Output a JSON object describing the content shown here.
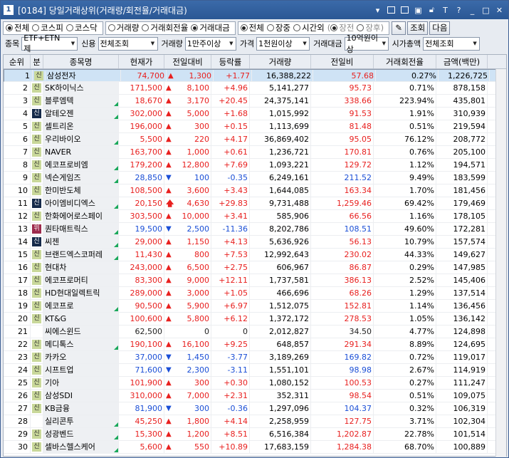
{
  "window": {
    "number": "1",
    "title": "[0184] 당일거래상위(거래량/회전율/거래대금)"
  },
  "toolbar1": {
    "market": [
      "전체",
      "코스피",
      "코스닥"
    ],
    "sort": [
      "거래량",
      "거래회전율",
      "거래대금"
    ],
    "session": [
      "전체",
      "장중",
      "시간외"
    ],
    "timeopt": [
      "장전",
      "장후"
    ],
    "query": "조회",
    "next": "다음"
  },
  "toolbar2": {
    "item_label": "종목",
    "item_value": "ETF+ETN 제",
    "credit_label": "신용",
    "credit_value": "전체조회",
    "volume_label": "거래량",
    "volume_value": "1만주이상",
    "price_label": "가격",
    "price_value": "1천원이상",
    "amount_label": "거래대금",
    "amount_value": "10억원이상",
    "cap_label": "시가총액",
    "cap_value": "전체조회"
  },
  "headers": [
    "순위",
    "분",
    "종목명",
    "현재가",
    "전일대비",
    "등락률",
    "거래량",
    "전일비",
    "거래회전율",
    "금액(백만)"
  ],
  "rows": [
    {
      "rank": "1",
      "badge": "신",
      "bt": "g",
      "name": "삼성전자",
      "price": "74,700",
      "dir": "up",
      "chg": "1,300",
      "rate": "+1.77",
      "vol": "16,388,222",
      "prev": "57.68",
      "turn": "0.27%",
      "amt": "1,226,725",
      "tri": false,
      "sel": true
    },
    {
      "rank": "2",
      "badge": "신",
      "bt": "g",
      "name": "SK하이닉스",
      "price": "171,500",
      "dir": "up",
      "chg": "8,100",
      "rate": "+4.96",
      "vol": "5,141,277",
      "prev": "95.73",
      "turn": "0.71%",
      "amt": "878,158",
      "tri": false
    },
    {
      "rank": "3",
      "badge": "신",
      "bt": "g",
      "name": "블루엠텍",
      "price": "18,670",
      "dir": "up",
      "chg": "3,170",
      "rate": "+20.45",
      "vol": "24,375,141",
      "prev": "338.66",
      "turn": "223.94%",
      "amt": "435,801",
      "tri": true
    },
    {
      "rank": "4",
      "badge": "신",
      "bt": "k",
      "name": "알테오젠",
      "price": "302,000",
      "dir": "up",
      "chg": "5,000",
      "rate": "+1.68",
      "vol": "1,015,992",
      "prev": "91.53",
      "turn": "1.91%",
      "amt": "310,939",
      "tri": true
    },
    {
      "rank": "5",
      "badge": "신",
      "bt": "g",
      "name": "셀트리온",
      "price": "196,000",
      "dir": "up",
      "chg": "300",
      "rate": "+0.15",
      "vol": "1,113,699",
      "prev": "81.48",
      "turn": "0.51%",
      "amt": "219,594",
      "tri": false
    },
    {
      "rank": "6",
      "badge": "신",
      "bt": "g",
      "name": "우리바이오",
      "price": "5,500",
      "dir": "up",
      "chg": "220",
      "rate": "+4.17",
      "vol": "36,869,402",
      "prev": "95.05",
      "turn": "76.12%",
      "amt": "208,772",
      "tri": true
    },
    {
      "rank": "7",
      "badge": "신",
      "bt": "g",
      "name": "NAVER",
      "price": "163,700",
      "dir": "up",
      "chg": "1,000",
      "rate": "+0.61",
      "vol": "1,236,721",
      "prev": "170.81",
      "turn": "0.76%",
      "amt": "205,100",
      "tri": false
    },
    {
      "rank": "8",
      "badge": "신",
      "bt": "g",
      "name": "에코프로비엠",
      "price": "179,200",
      "dir": "up",
      "chg": "12,800",
      "rate": "+7.69",
      "vol": "1,093,221",
      "prev": "129.72",
      "turn": "1.12%",
      "amt": "194,571",
      "tri": true
    },
    {
      "rank": "9",
      "badge": "신",
      "bt": "g",
      "name": "넥슨게임즈",
      "price": "28,850",
      "dir": "down",
      "chg": "100",
      "rate": "-0.35",
      "vol": "6,249,161",
      "prev": "211.52",
      "turn": "9.49%",
      "amt": "183,599",
      "tri": true
    },
    {
      "rank": "10",
      "badge": "신",
      "bt": "g",
      "name": "한미반도체",
      "price": "108,500",
      "dir": "up",
      "chg": "3,600",
      "rate": "+3.43",
      "vol": "1,644,085",
      "prev": "163.34",
      "turn": "1.70%",
      "amt": "181,456",
      "tri": false
    },
    {
      "rank": "11",
      "badge": "신",
      "bt": "k",
      "name": "아이엠비디엑스",
      "price": "20,150",
      "dir": "upper",
      "chg": "4,630",
      "rate": "+29.83",
      "vol": "9,731,488",
      "prev": "1,259.46",
      "turn": "69.42%",
      "amt": "179,469",
      "tri": true
    },
    {
      "rank": "12",
      "badge": "신",
      "bt": "g",
      "name": "한화에어로스페이",
      "price": "303,500",
      "dir": "up",
      "chg": "10,000",
      "rate": "+3.41",
      "vol": "585,906",
      "prev": "66.56",
      "turn": "1.16%",
      "amt": "178,105",
      "tri": false
    },
    {
      "rank": "13",
      "badge": "위",
      "bt": "r",
      "name": "퀀타매트릭스",
      "price": "19,500",
      "dir": "down",
      "chg": "2,500",
      "rate": "-11.36",
      "vol": "8,202,786",
      "prev": "108.51",
      "turn": "49.60%",
      "amt": "172,281",
      "tri": true
    },
    {
      "rank": "14",
      "badge": "신",
      "bt": "k",
      "name": "씨젠",
      "price": "29,000",
      "dir": "up",
      "chg": "1,150",
      "rate": "+4.13",
      "vol": "5,636,926",
      "prev": "56.13",
      "turn": "10.79%",
      "amt": "157,574",
      "tri": true
    },
    {
      "rank": "15",
      "badge": "신",
      "bt": "g",
      "name": "브랜드엑스코퍼레",
      "price": "11,430",
      "dir": "up",
      "chg": "800",
      "rate": "+7.53",
      "vol": "12,992,643",
      "prev": "230.02",
      "turn": "44.33%",
      "amt": "149,627",
      "tri": true
    },
    {
      "rank": "16",
      "badge": "신",
      "bt": "g",
      "name": "현대차",
      "price": "243,000",
      "dir": "up",
      "chg": "6,500",
      "rate": "+2.75",
      "vol": "606,967",
      "prev": "86.87",
      "turn": "0.29%",
      "amt": "147,985",
      "tri": false
    },
    {
      "rank": "17",
      "badge": "신",
      "bt": "g",
      "name": "에코프로머티",
      "price": "83,300",
      "dir": "up",
      "chg": "9,000",
      "rate": "+12.11",
      "vol": "1,737,581",
      "prev": "386.13",
      "turn": "2.52%",
      "amt": "145,406",
      "tri": false
    },
    {
      "rank": "18",
      "badge": "신",
      "bt": "g",
      "name": "HD현대일렉트릭",
      "price": "289,000",
      "dir": "up",
      "chg": "3,000",
      "rate": "+1.05",
      "vol": "466,696",
      "prev": "68.26",
      "turn": "1.29%",
      "amt": "137,514",
      "tri": false
    },
    {
      "rank": "19",
      "badge": "신",
      "bt": "g",
      "name": "에코프로",
      "price": "90,500",
      "dir": "up",
      "chg": "5,900",
      "rate": "+6.97",
      "vol": "1,512,075",
      "prev": "152.81",
      "turn": "1.14%",
      "amt": "136,456",
      "tri": true
    },
    {
      "rank": "20",
      "badge": "신",
      "bt": "g",
      "name": "KT&G",
      "price": "100,600",
      "dir": "up",
      "chg": "5,800",
      "rate": "+6.12",
      "vol": "1,372,172",
      "prev": "278.53",
      "turn": "1.05%",
      "amt": "136,142",
      "tri": false
    },
    {
      "rank": "21",
      "badge": "",
      "bt": "",
      "name": "씨에스윈드",
      "price": "62,500",
      "dir": "flat",
      "chg": "0",
      "rate": "0",
      "vol": "2,012,827",
      "prev": "34.50",
      "turn": "4.77%",
      "amt": "124,898",
      "tri": false
    },
    {
      "rank": "22",
      "badge": "신",
      "bt": "g",
      "name": "메디톡스",
      "price": "190,100",
      "dir": "up",
      "chg": "16,100",
      "rate": "+9.25",
      "vol": "648,857",
      "prev": "291.34",
      "turn": "8.89%",
      "amt": "124,695",
      "tri": true
    },
    {
      "rank": "23",
      "badge": "신",
      "bt": "g",
      "name": "카카오",
      "price": "37,000",
      "dir": "down",
      "chg": "1,450",
      "rate": "-3.77",
      "vol": "3,189,269",
      "prev": "169.82",
      "turn": "0.72%",
      "amt": "119,017",
      "tri": false
    },
    {
      "rank": "24",
      "badge": "신",
      "bt": "g",
      "name": "시프트업",
      "price": "71,600",
      "dir": "down",
      "chg": "2,300",
      "rate": "-3.11",
      "vol": "1,551,101",
      "prev": "98.98",
      "turn": "2.67%",
      "amt": "114,919",
      "tri": false
    },
    {
      "rank": "25",
      "badge": "신",
      "bt": "g",
      "name": "기아",
      "price": "101,900",
      "dir": "up",
      "chg": "300",
      "rate": "+0.30",
      "vol": "1,080,152",
      "prev": "100.53",
      "turn": "0.27%",
      "amt": "111,247",
      "tri": false
    },
    {
      "rank": "26",
      "badge": "신",
      "bt": "g",
      "name": "삼성SDI",
      "price": "310,000",
      "dir": "up",
      "chg": "7,000",
      "rate": "+2.31",
      "vol": "352,311",
      "prev": "98.54",
      "turn": "0.51%",
      "amt": "109,075",
      "tri": false
    },
    {
      "rank": "27",
      "badge": "신",
      "bt": "g",
      "name": "KB금융",
      "price": "81,900",
      "dir": "down",
      "chg": "300",
      "rate": "-0.36",
      "vol": "1,297,096",
      "prev": "104.37",
      "turn": "0.32%",
      "amt": "106,319",
      "tri": false
    },
    {
      "rank": "28",
      "badge": "",
      "bt": "",
      "name": "실리콘투",
      "price": "45,250",
      "dir": "up",
      "chg": "1,800",
      "rate": "+4.14",
      "vol": "2,258,959",
      "prev": "127.75",
      "turn": "3.71%",
      "amt": "102,304",
      "tri": true
    },
    {
      "rank": "29",
      "badge": "신",
      "bt": "g",
      "name": "성광벤드",
      "price": "15,300",
      "dir": "up",
      "chg": "1,200",
      "rate": "+8.51",
      "vol": "6,516,384",
      "prev": "1,202.87",
      "turn": "22.78%",
      "amt": "101,514",
      "tri": true
    },
    {
      "rank": "30",
      "badge": "신",
      "bt": "g",
      "name": "셀바스헬스케어",
      "price": "5,600",
      "dir": "up",
      "chg": "550",
      "rate": "+10.89",
      "vol": "17,683,159",
      "prev": "1,284.38",
      "turn": "68.70%",
      "amt": "100,889",
      "tri": true
    }
  ]
}
